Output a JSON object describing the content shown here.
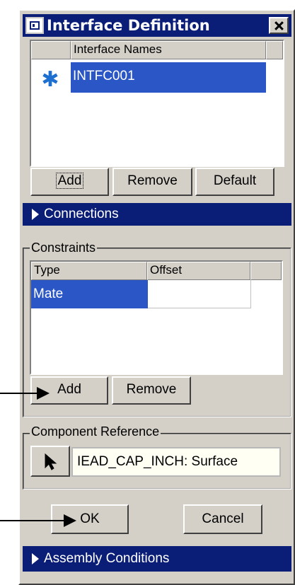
{
  "dialog": {
    "title": "Interface Definition"
  },
  "interface_list": {
    "column_header": "Interface Names",
    "rows": [
      {
        "marker": "✱",
        "name": "INTFC001"
      }
    ],
    "buttons": {
      "add": "Add",
      "remove": "Remove",
      "default": "Default"
    }
  },
  "sections": {
    "connections": "Connections",
    "assembly_conditions": "Assembly Conditions"
  },
  "constraints": {
    "group_label": "Constraints",
    "headers": {
      "type": "Type",
      "offset": "Offset"
    },
    "rows": [
      {
        "type": "Mate",
        "offset": ""
      }
    ],
    "buttons": {
      "add": "Add",
      "remove": "Remove"
    }
  },
  "component_reference": {
    "group_label": "Component Reference",
    "value": "IEAD_CAP_INCH: Surface"
  },
  "footer": {
    "ok": "OK",
    "cancel": "Cancel"
  },
  "colors": {
    "title_bar": "#0a1e78",
    "selection": "#2a56c6",
    "dialog_bg": "#d4d0c8"
  }
}
